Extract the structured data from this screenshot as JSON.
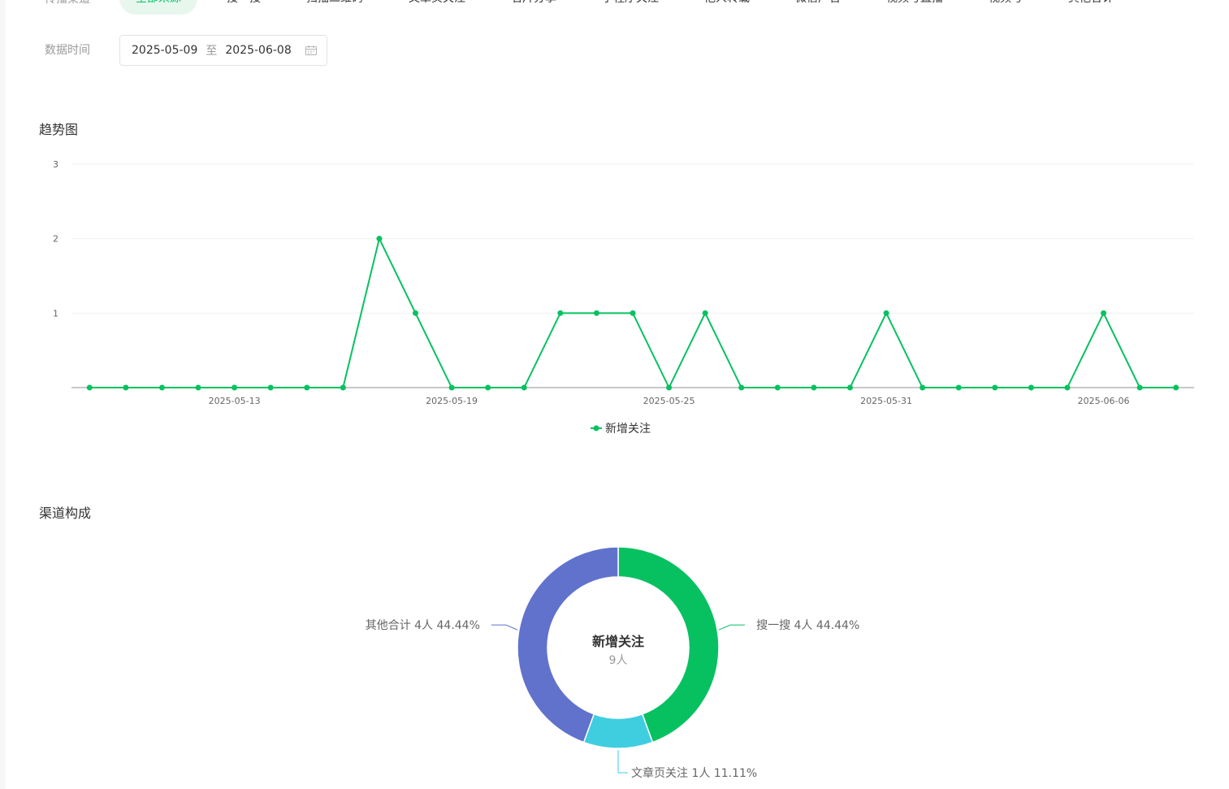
{
  "filters": {
    "channel_label": "传播渠道",
    "channels": [
      "全部来源",
      "搜一搜",
      "扫描二维码",
      "文章页关注",
      "名片分享",
      "小程序关注",
      "他人转载",
      "微信广告",
      "视频号直播",
      "视频号",
      "其他合计"
    ],
    "active_channel_index": 0,
    "date_label": "数据时间",
    "date_start": "2025-05-09",
    "date_separator": "至",
    "date_end": "2025-06-08",
    "calendar_icon": "calendar-icon"
  },
  "trend": {
    "title": "趋势图"
  },
  "composition": {
    "title": "渠道构成"
  },
  "colors": {
    "accent": "#07c160",
    "donut": [
      "#07c160",
      "#3fcee0",
      "#6172cc"
    ]
  },
  "chart_data": [
    {
      "type": "line",
      "x": [
        "2025-05-09",
        "2025-05-10",
        "2025-05-11",
        "2025-05-12",
        "2025-05-13",
        "2025-05-14",
        "2025-05-15",
        "2025-05-16",
        "2025-05-17",
        "2025-05-18",
        "2025-05-19",
        "2025-05-20",
        "2025-05-21",
        "2025-05-22",
        "2025-05-23",
        "2025-05-24",
        "2025-05-25",
        "2025-05-26",
        "2025-05-27",
        "2025-05-28",
        "2025-05-29",
        "2025-05-30",
        "2025-05-31",
        "2025-06-01",
        "2025-06-02",
        "2025-06-03",
        "2025-06-04",
        "2025-06-05",
        "2025-06-06",
        "2025-06-07",
        "2025-06-08"
      ],
      "x_tick_labels": [
        "2025-05-13",
        "2025-05-19",
        "2025-05-25",
        "2025-05-31",
        "2025-06-06"
      ],
      "series": [
        {
          "name": "新增关注",
          "values": [
            0,
            0,
            0,
            0,
            0,
            0,
            0,
            0,
            2,
            1,
            0,
            0,
            0,
            1,
            1,
            1,
            0,
            1,
            0,
            0,
            0,
            0,
            1,
            0,
            0,
            0,
            0,
            0,
            1,
            0,
            0
          ]
        }
      ],
      "ylim": [
        0,
        3
      ],
      "y_ticks": [
        1,
        2,
        3
      ],
      "grid": true,
      "legend": "bottom-center"
    },
    {
      "type": "pie",
      "center_title": "新增关注",
      "center_value": "9人",
      "slices": [
        {
          "name": "搜一搜",
          "value": 4,
          "count_label": "4人",
          "percent": "44.44%"
        },
        {
          "name": "文章页关注",
          "value": 1,
          "count_label": "1人",
          "percent": "11.11%"
        },
        {
          "name": "其他合计",
          "value": 4,
          "count_label": "4人",
          "percent": "44.44%"
        }
      ]
    }
  ]
}
